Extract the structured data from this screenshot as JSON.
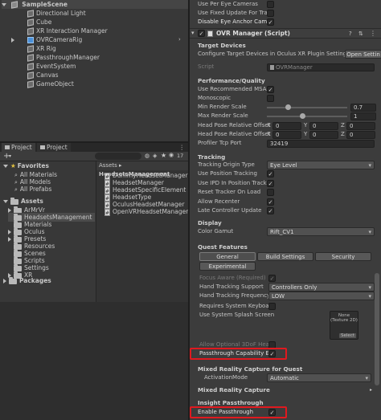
{
  "hierarchy": {
    "scene": "SampleScene",
    "items": [
      {
        "label": "Directional Light",
        "icon": "cube-icon"
      },
      {
        "label": "Cube",
        "icon": "cube-icon"
      },
      {
        "label": "XR Interaction Manager",
        "icon": "cube-icon"
      },
      {
        "label": "OVRCameraRig",
        "icon": "prefab-icon"
      },
      {
        "label": "XR Rig",
        "icon": "cube-icon"
      },
      {
        "label": "PassthroughManager",
        "icon": "cube-icon"
      },
      {
        "label": "EventSystem",
        "icon": "cube-icon"
      },
      {
        "label": "Canvas",
        "icon": "cube-icon"
      },
      {
        "label": "GameObject",
        "icon": "cube-icon"
      }
    ]
  },
  "project_panel": {
    "tabs": [
      "Project",
      "Project"
    ],
    "plus_label": "+",
    "badge_count": "17",
    "breadcrumb": [
      "Assets",
      "HeadsetsManagement"
    ],
    "favorites_label": "Favorites",
    "favorites": [
      "All Materials",
      "All Models",
      "All Prefabs"
    ],
    "assets_label": "Assets",
    "assets": [
      "ArMrVr",
      "HeadsetsManagement",
      "Materials",
      "Oculus",
      "Presets",
      "Resources",
      "Scenes",
      "Scripts",
      "Settings",
      "XR"
    ],
    "packages_label": "Packages",
    "files": [
      "DummyHeadsetManager",
      "HeadsetManager",
      "HeadsetSpecificElement",
      "HeadsetType",
      "OculusHeadsetManager",
      "OpenVRHeadsetManager"
    ]
  },
  "inspector": {
    "top_rows": [
      "Use Per Eye Cameras",
      "Use Fixed Update For Trac",
      "Disable Eye Anchor Came"
    ],
    "component_title": "OVR Manager (Script)",
    "target_devices": {
      "header": "Target Devices",
      "text": "Configure Target Devices in Oculus XR Plugin Settings.",
      "button": "Open Settin"
    },
    "script_label": "Script",
    "script_value": "OVRManager",
    "perf_header": "Performance/Quality",
    "perf_rows": [
      {
        "label": "Use Recommended MSAA",
        "checked": true
      },
      {
        "label": "Monoscopic",
        "checked": false
      }
    ],
    "min_render_scale": {
      "label": "Min Render Scale",
      "value": "0.7",
      "fraction": 0.7
    },
    "max_render_scale": {
      "label": "Max Render Scale",
      "value": "1",
      "fraction": 1.0
    },
    "head_pos_rows": [
      {
        "label": "Head Pose Relative Offset",
        "x": "0",
        "y": "0",
        "z": "0"
      },
      {
        "label": "Head Pose Relative Offset",
        "x": "0",
        "y": "0",
        "z": "0"
      }
    ],
    "profiler": {
      "label": "Profiler Tcp Port",
      "value": "32419"
    },
    "tracking_header": "Tracking",
    "tracking_origin": {
      "label": "Tracking Origin Type",
      "value": "Eye Level"
    },
    "tracking_rows": [
      {
        "label": "Use Position Tracking",
        "checked": true
      },
      {
        "label": "Use IPD In Position Trackin",
        "checked": true
      },
      {
        "label": "Reset Tracker On Load",
        "checked": false
      },
      {
        "label": "Allow Recenter",
        "checked": true
      },
      {
        "label": "Late Controller Update",
        "checked": true
      }
    ],
    "display_header": "Display",
    "color_gamut": {
      "label": "Color Gamut",
      "value": "Rift_CV1"
    },
    "quest_header": "Quest Features",
    "quest_tabs": [
      "General",
      "Build Settings",
      "Security",
      "Experimental"
    ],
    "focus_aware": "Focus Aware (Required)",
    "hand_support": {
      "label": "Hand Tracking Support",
      "value": "Controllers Only"
    },
    "hand_freq": {
      "label": "Hand Tracking Frequency",
      "value": "LOW"
    },
    "system_keyboard": "Requires System Keyboar",
    "splash": {
      "label": "Use System Splash Screen",
      "none": "None",
      "texture": "(Texture 2D)",
      "select": "Select"
    },
    "allow_3dof": "Allow Optional 3DoF Head",
    "passthrough_capability": "Passthrough Capability En",
    "mrc_header": "Mixed Reality Capture for Quest",
    "activation": {
      "label": "ActivationMode",
      "value": "Automatic"
    },
    "mrc2_header": "Mixed Reality Capture",
    "insight_header": "Insight Passthrough",
    "enable_passthrough": "Enable Passthrough"
  },
  "colors": {
    "highlight": "#e0191f",
    "selected": "#2c5d87"
  }
}
